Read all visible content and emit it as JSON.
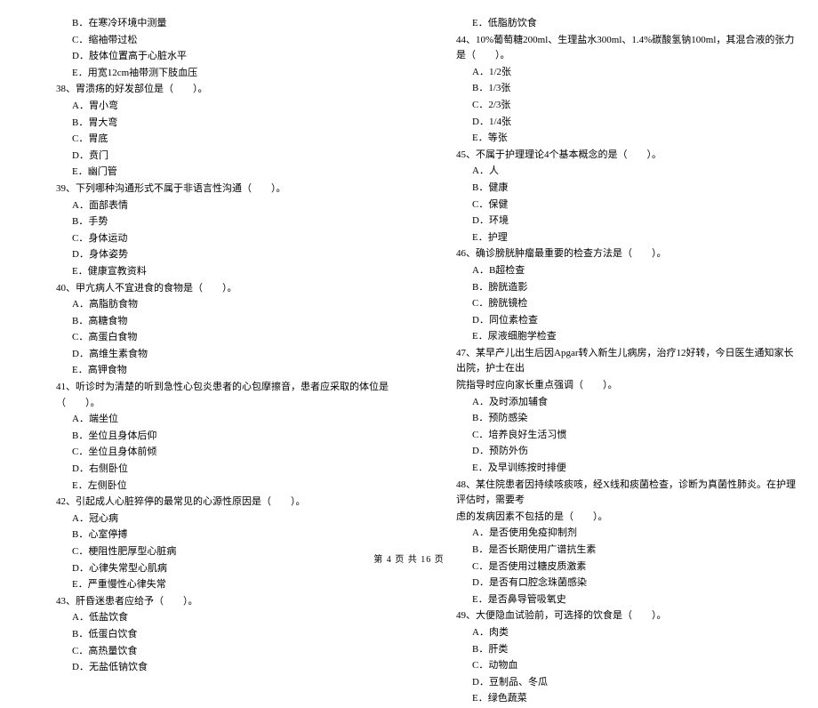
{
  "left": {
    "q37opts": [
      "B．在寒冷环境中测量",
      "C．缩袖带过松",
      "D．肢体位置高于心脏水平",
      "E．用宽12cm袖带测下肢血压"
    ],
    "q38": {
      "stem": "38、胃溃疡的好发部位是（　　）。",
      "opts": [
        "A．胃小弯",
        "B．胃大弯",
        "C．胃底",
        "D．贲门",
        "E．幽门管"
      ]
    },
    "q39": {
      "stem": "39、下列哪种沟通形式不属于非语言性沟通（　　）。",
      "opts": [
        "A．面部表情",
        "B．手势",
        "C．身体运动",
        "D．身体姿势",
        "E．健康宣教资料"
      ]
    },
    "q40": {
      "stem": "40、甲亢病人不宜进食的食物是（　　）。",
      "opts": [
        "A．高脂肪食物",
        "B．高糖食物",
        "C．高蛋白食物",
        "D．高维生素食物",
        "E．高钾食物"
      ]
    },
    "q41": {
      "stem": "41、听诊时为清楚的听到急性心包炎患者的心包摩擦音，患者应采取的体位是（　　）。",
      "opts": [
        "A．端坐位",
        "B．坐位且身体后仰",
        "C．坐位且身体前倾",
        "D．右侧卧位",
        "E．左侧卧位"
      ]
    },
    "q42": {
      "stem": "42、引起成人心脏猝停的最常见的心源性原因是（　　）。",
      "opts": [
        "A．冠心病",
        "B．心室停搏",
        "C．梗阻性肥厚型心脏病",
        "D．心律失常型心肌病",
        "E．严重慢性心律失常"
      ]
    },
    "q43": {
      "stem": "43、肝昏迷患者应给予（　　）。",
      "opts": [
        "A．低盐饮食",
        "B．低蛋白饮食",
        "C．高热量饮食",
        "D．无盐低钠饮食"
      ]
    }
  },
  "right": {
    "q43e": "E．低脂肪饮食",
    "q44": {
      "stem": "44、10%葡萄糖200ml、生理盐水300ml、1.4%碳酸氢钠100ml，其混合液的张力是（　　）。",
      "opts": [
        "A．1/2张",
        "B．1/3张",
        "C．2/3张",
        "D．1/4张",
        "E．等张"
      ]
    },
    "q45": {
      "stem": "45、不属于护理理论4个基本概念的是（　　）。",
      "opts": [
        "A．人",
        "B．健康",
        "C．保健",
        "D．环境",
        "E．护理"
      ]
    },
    "q46": {
      "stem": "46、确诊膀胱肿瘤最重要的检查方法是（　　）。",
      "opts": [
        "A．B超检查",
        "B．膀胱造影",
        "C．膀胱镜检",
        "D．同位素检查",
        "E．尿液细胞学检查"
      ]
    },
    "q47": {
      "stem": "47、某早产儿出生后因Apgar转入新生儿病房，治疗12好转，今日医生通知家长出院，护士在出",
      "stemCont": "院指导时应向家长重点强调（　　）。",
      "opts": [
        "A．及时添加辅食",
        "B．预防感染",
        "C．培养良好生活习惯",
        "D．预防外伤",
        "E．及早训练按时排便"
      ]
    },
    "q48": {
      "stem": "48、某住院患者因持续咳痰咳，经X线和痰菌检查，诊断为真菌性肺炎。在护理评估时，需要考",
      "stemCont": "虑的发病因素不包括的是（　　）。",
      "opts": [
        "A．是否使用免疫抑制剂",
        "B．是否长期使用广谱抗生素",
        "C．是否使用过糖皮质激素",
        "D．是否有口腔念珠菌感染",
        "E．是否鼻导管吸氧史"
      ]
    },
    "q49": {
      "stem": "49、大便隐血试验前，可选择的饮食是（　　）。",
      "opts": [
        "A．肉类",
        "B．肝类",
        "C．动物血",
        "D．豆制品、冬瓜",
        "E．绿色蔬菜"
      ]
    }
  },
  "footer": "第 4 页 共 16 页"
}
